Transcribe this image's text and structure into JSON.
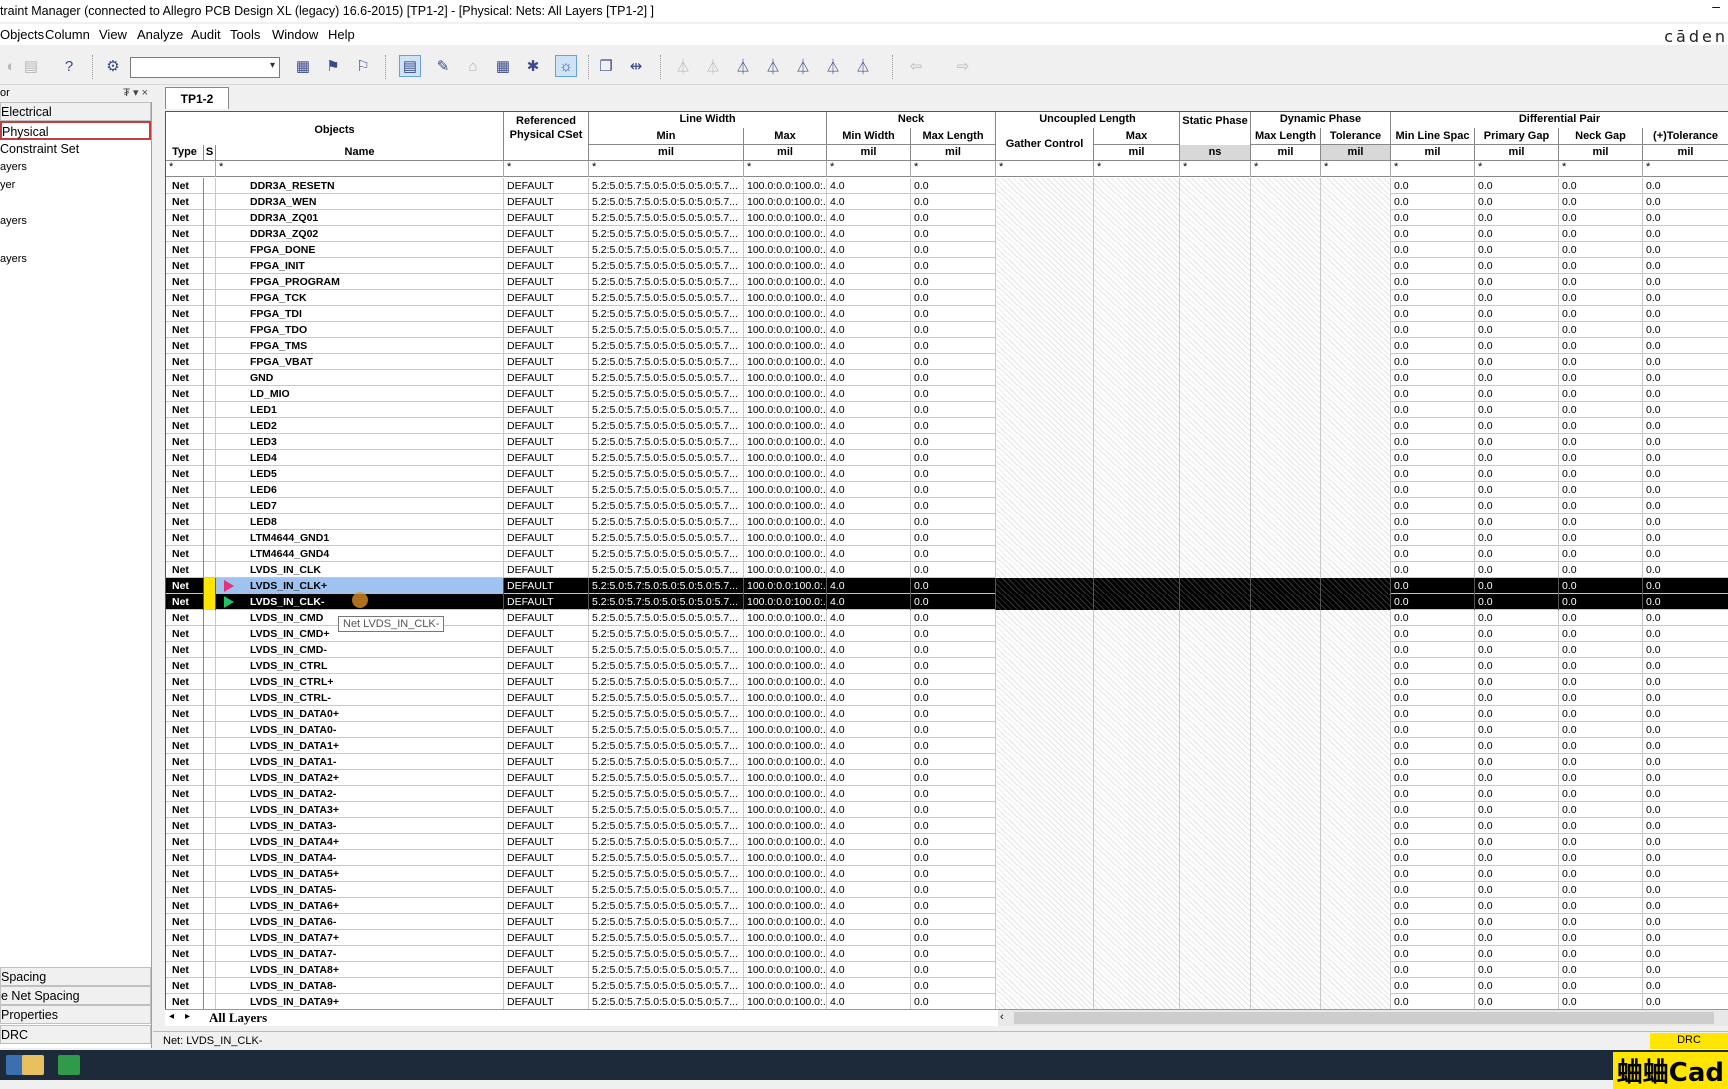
{
  "window": {
    "title": "traint Manager (connected to Allegro PCB Design XL (legacy) 16.6-2015) [TP1-2] - [Physical:  Nets:  All Layers [TP1-2] ]",
    "min_glyph": "–",
    "brand": "cāden"
  },
  "menu": [
    "Objects",
    "Column",
    "View",
    "Analyze",
    "Audit",
    "Tools",
    "Window",
    "Help"
  ],
  "toolbar": {
    "combo_value": "",
    "combo_arrow": "▾"
  },
  "sidebar": {
    "header": "or",
    "header_controls": "₮ ▾ ×",
    "categories_top": [
      "Electrical",
      "Physical"
    ],
    "constraint_set": "Constraint Set",
    "leaves": [
      "ayers",
      "yer",
      "ayers",
      "ayers"
    ],
    "categories_bottom": [
      "Spacing",
      "e Net Spacing",
      "Properties",
      "DRC"
    ]
  },
  "tab": "TP1-2",
  "grid": {
    "headers": {
      "objects": "Objects",
      "type": "Type",
      "s": "S",
      "name": "Name",
      "ref_cset": "Referenced Physical CSet",
      "line_width": "Line Width",
      "lw_min": "Min",
      "lw_max": "Max",
      "neck": "Neck",
      "neck_min_width": "Min Width",
      "neck_max_length": "Max Length",
      "uncoupled": "Uncoupled Length",
      "gather": "Gather Control",
      "unc_max": "Max",
      "static_phase": "Static Phase",
      "dynamic_phase": "Dynamic Phase",
      "dyn_max_length": "Max Length",
      "dyn_tolerance": "Tolerance",
      "diff_pair": "Differential Pair",
      "min_line_spac": "Min Line Spac",
      "primary_gap": "Primary Gap",
      "neck_gap": "Neck Gap",
      "tolerance_plus": "(+)Tolerance"
    },
    "units": {
      "mil": "mil",
      "ns": "ns"
    },
    "filter": "*",
    "row_defaults": {
      "type": "Net",
      "cset": "DEFAULT",
      "lw_min": "5.2:5.0:5.7:5.0:5.0:5.0:5.0:5.7...",
      "lw_max": "100.0:0.0:100.0:...",
      "neck_min_width": "4.0",
      "neck_max_length": "0.0",
      "dp_value": "0.0"
    },
    "rows": [
      "DDR3A_RESETN",
      "DDR3A_WEN",
      "DDR3A_ZQ01",
      "DDR3A_ZQ02",
      "FPGA_DONE",
      "FPGA_INIT",
      "FPGA_PROGRAM",
      "FPGA_TCK",
      "FPGA_TDI",
      "FPGA_TDO",
      "FPGA_TMS",
      "FPGA_VBAT",
      "GND",
      "LD_MIO",
      "LED1",
      "LED2",
      "LED3",
      "LED4",
      "LED5",
      "LED6",
      "LED7",
      "LED8",
      "LTM4644_GND1",
      "LTM4644_GND4",
      "LVDS_IN_CLK",
      "LVDS_IN_CLK+",
      "LVDS_IN_CLK-",
      "LVDS_IN_CMD",
      "LVDS_IN_CMD+",
      "LVDS_IN_CMD-",
      "LVDS_IN_CTRL",
      "LVDS_IN_CTRL+",
      "LVDS_IN_CTRL-",
      "LVDS_IN_DATA0+",
      "LVDS_IN_DATA0-",
      "LVDS_IN_DATA1+",
      "LVDS_IN_DATA1-",
      "LVDS_IN_DATA2+",
      "LVDS_IN_DATA2-",
      "LVDS_IN_DATA3+",
      "LVDS_IN_DATA3-",
      "LVDS_IN_DATA4+",
      "LVDS_IN_DATA4-",
      "LVDS_IN_DATA5+",
      "LVDS_IN_DATA5-",
      "LVDS_IN_DATA6+",
      "LVDS_IN_DATA6-",
      "LVDS_IN_DATA7+",
      "LVDS_IN_DATA7-",
      "LVDS_IN_DATA8+",
      "LVDS_IN_DATA8-",
      "LVDS_IN_DATA9+"
    ],
    "highlighted_rows": [
      "LVDS_IN_CLK+",
      "LVDS_IN_CLK-"
    ]
  },
  "tooltip": "Net LVDS_IN_CLK-",
  "sheet_tab": "All Layers",
  "sheet_nav": [
    "◂",
    "▸"
  ],
  "scroll_left": "‹",
  "status": {
    "message": "Net: LVDS_IN_CLK-",
    "drc": "DRC"
  },
  "watermark": "蛐蛐Cad",
  "colors": {
    "highlight_row": "#000000",
    "selected_name": "#9ec3f0",
    "s_marker": "#ffe500",
    "mark_pink": "#e3317a",
    "mark_green": "#23c06a",
    "sidebar_sel_border": "#c04040"
  }
}
